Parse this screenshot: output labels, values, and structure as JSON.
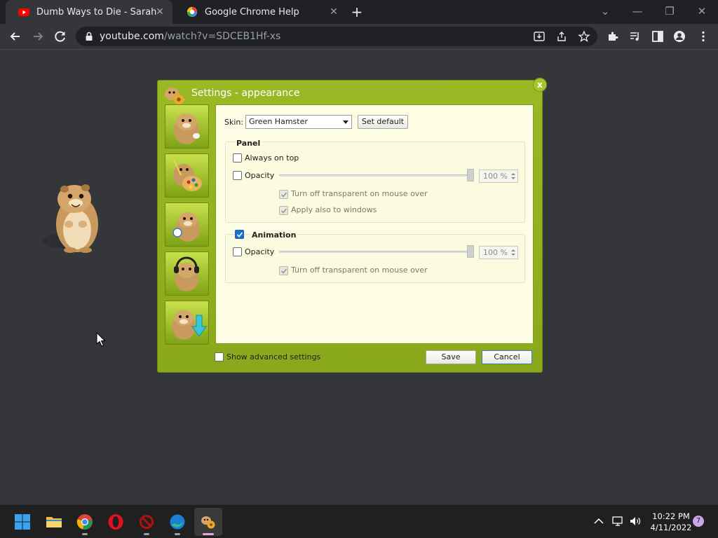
{
  "browser": {
    "tabs": [
      {
        "title": "Dumb Ways to Die - Sarah - You",
        "icon": "youtube-icon"
      },
      {
        "title": "Google Chrome Help",
        "icon": "google-icon"
      }
    ],
    "url_host": "youtube.com",
    "url_path": "/watch?v=SDCEB1Hf-xs"
  },
  "dialog": {
    "title": "Settings - appearance",
    "close_label": "x",
    "skin_label": "Skin:",
    "skin_value": "Green Hamster",
    "set_default_label": "Set default",
    "panel": {
      "title": "Panel",
      "always_on_top_label": "Always on top",
      "always_on_top_checked": false,
      "opacity_label": "Opacity",
      "opacity_checked": false,
      "opacity_value": "100 %",
      "opacity_level": 1.0,
      "turn_off_transparent_label": "Turn off transparent on mouse over",
      "apply_windows_label": "Apply also to windows"
    },
    "animation": {
      "title": "Animation",
      "enabled": true,
      "opacity_label": "Opacity",
      "opacity_checked": false,
      "opacity_value": "100 %",
      "opacity_level": 1.0,
      "turn_off_transparent_label": "Turn off transparent on mouse over"
    },
    "show_advanced_label": "Show advanced settings",
    "save_label": "Save",
    "cancel_label": "Cancel"
  },
  "taskbar": {
    "time": "10:22 PM",
    "date": "4/11/2022",
    "notification_count": "7"
  },
  "colors": {
    "dialog_green": "#8fae1f",
    "content_bg": "#fdfde6",
    "chrome_dark": "#202124",
    "checkbox_blue": "#1a6fd0"
  }
}
